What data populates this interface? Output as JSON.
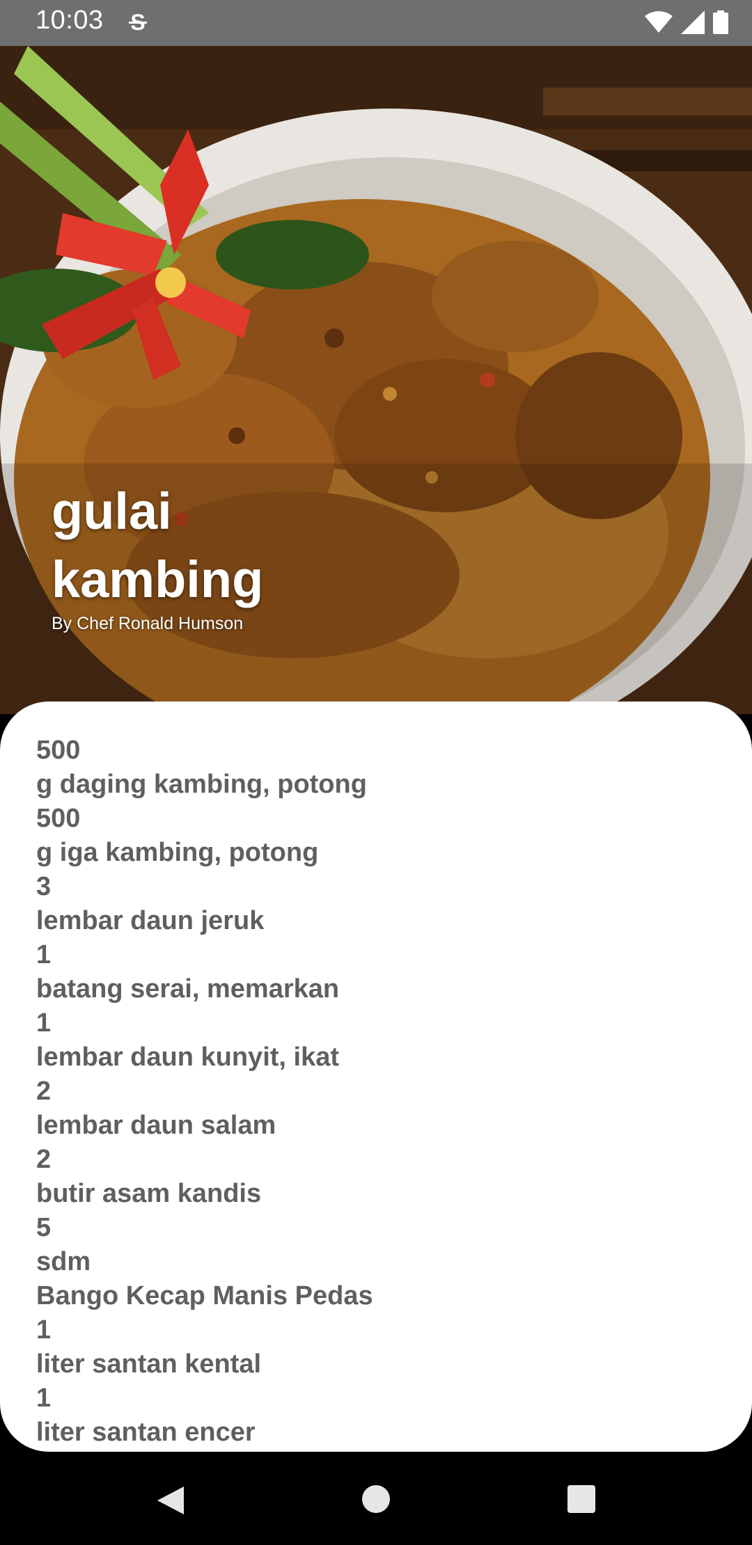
{
  "status_bar": {
    "time": "10:03"
  },
  "recipe": {
    "title": "gulai kambing",
    "author": "By Chef Ronald Humson"
  },
  "ingredients": [
    {
      "qty": "500",
      "desc": "g daging kambing, potong"
    },
    {
      "qty": "500",
      "desc": "g iga kambing, potong"
    },
    {
      "qty": "3",
      "desc": "lembar daun jeruk"
    },
    {
      "qty": "1",
      "desc": "batang serai, memarkan"
    },
    {
      "qty": "1",
      "desc": "lembar daun kunyit, ikat"
    },
    {
      "qty": "2",
      "desc": "lembar daun salam"
    },
    {
      "qty": "2",
      "desc": "butir asam kandis"
    },
    {
      "qty": "5",
      "desc": "sdm"
    },
    {
      "qty": "Bango Kecap Manis Pedas",
      "desc": "1"
    },
    {
      "qty": "liter santan kental",
      "desc": "1"
    },
    {
      "qty": "liter santan encer",
      "desc": ""
    }
  ],
  "icons": {
    "status": [
      "s-sync-icon",
      "wifi-icon",
      "signal-icon",
      "battery-icon"
    ],
    "nav": [
      "back-icon",
      "home-icon",
      "recents-icon"
    ]
  }
}
